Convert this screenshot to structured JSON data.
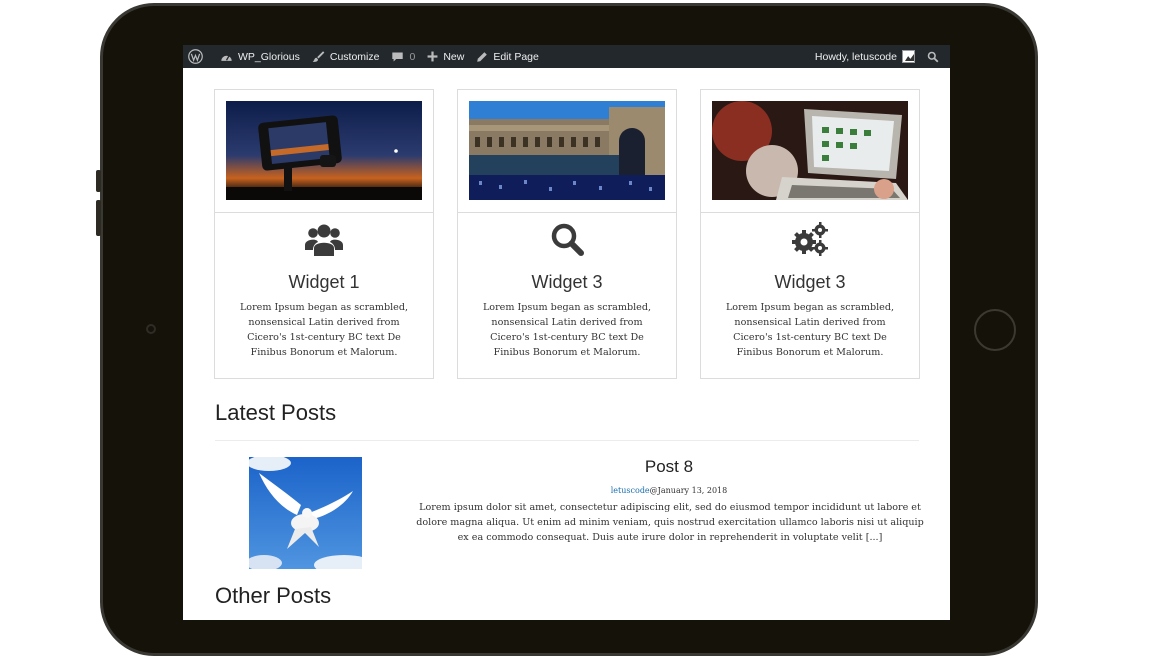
{
  "adminbar": {
    "site_name": "WP_Glorious",
    "customize": "Customize",
    "comments_count": "0",
    "new_label": "New",
    "edit_page": "Edit Page",
    "howdy": "Howdy, letuscode"
  },
  "widgets": [
    {
      "icon": "users-icon",
      "title": "Widget 1",
      "text": "Lorem Ipsum began as scrambled, nonsensical Latin derived from Cicero's 1st-century BC text De Finibus Bonorum et Malorum."
    },
    {
      "icon": "search-icon",
      "title": "Widget 3",
      "text": "Lorem Ipsum began as scrambled, nonsensical Latin derived from Cicero's 1st-century BC text De Finibus Bonorum et Malorum."
    },
    {
      "icon": "gears-icon",
      "title": "Widget 3",
      "text": "Lorem Ipsum began as scrambled, nonsensical Latin derived from Cicero's 1st-century BC text De Finibus Bonorum et Malorum."
    }
  ],
  "latest_posts": {
    "heading": "Latest Posts",
    "post": {
      "title": "Post 8",
      "author": "letuscode",
      "date": "@January 13, 2018",
      "excerpt": "Lorem ipsum dolor sit amet, consectetur adipiscing elit, sed do eiusmod tempor incididunt ut labore et dolore magna aliqua. Ut enim ad minim veniam, quis nostrud exercitation ullamco laboris nisi ut aliquip ex ea commodo consequat. Duis aute irure dolor in reprehenderit in voluptate velit [...]"
    }
  },
  "other_posts": {
    "heading": "Other Posts"
  },
  "colors": {
    "adminbar_bg": "#23282d",
    "tablet_frame": "#141209",
    "link": "#1a6fb0"
  }
}
